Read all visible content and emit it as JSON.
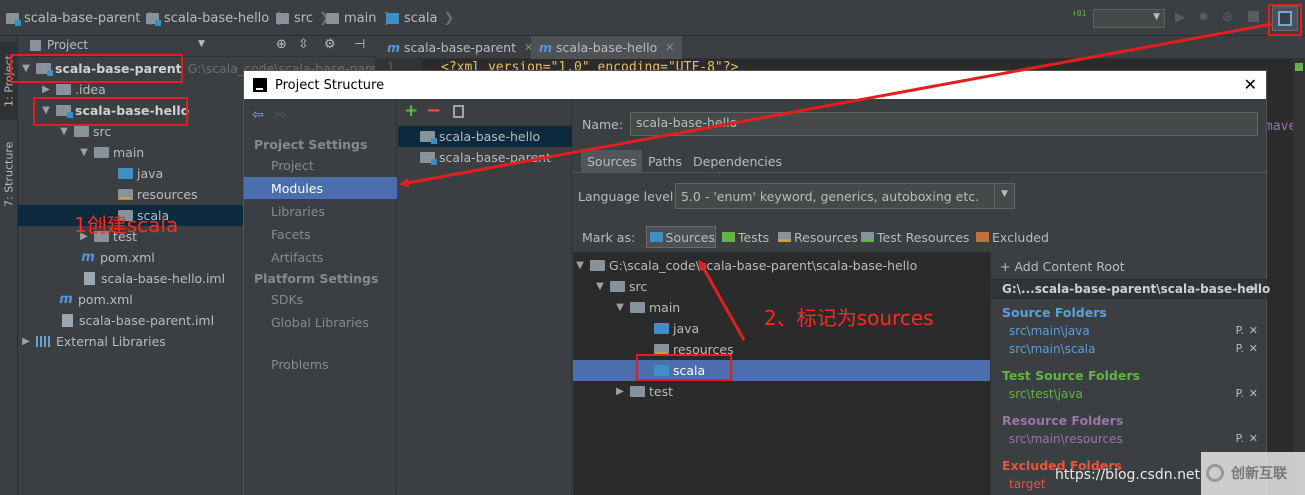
{
  "navbar": {
    "crumbs": [
      "scala-base-parent",
      "scala-base-hello",
      "src",
      "main",
      "scala"
    ]
  },
  "stripe": {
    "project_tab": "1: Project",
    "structure_tab": "7: Structure"
  },
  "project_panel": {
    "title": "Project",
    "tree": [
      {
        "label": "scala-base-parent",
        "path": "G:\\scala_code\\scala-base-parent"
      },
      {
        "label": ".idea"
      },
      {
        "label": "scala-base-hello"
      },
      {
        "label": "src"
      },
      {
        "label": "main"
      },
      {
        "label": "java"
      },
      {
        "label": "resources"
      },
      {
        "label": "scala"
      },
      {
        "label": "test"
      },
      {
        "label": "pom.xml"
      },
      {
        "label": "scala-base-hello.iml"
      },
      {
        "label": "pom.xml"
      },
      {
        "label": "scala-base-parent.iml"
      },
      {
        "label": "External Libraries"
      }
    ]
  },
  "editor": {
    "tabs": [
      {
        "label": "scala-base-parent"
      },
      {
        "label": "scala-base-hello"
      }
    ],
    "line_number": "1",
    "line1": "<?xml version=\"1.0\" encoding=\"UTF-8\"?>",
    "right_fragment": "maver"
  },
  "dialog": {
    "title": "Project Structure",
    "close": "✕",
    "nav": {
      "project_settings_header": "Project Settings",
      "project": "Project",
      "modules": "Modules",
      "libraries": "Libraries",
      "facets": "Facets",
      "artifacts": "Artifacts",
      "platform_settings_header": "Platform Settings",
      "sdks": "SDKs",
      "global_libraries": "Global Libraries",
      "problems": "Problems"
    },
    "modules": [
      "scala-base-hello",
      "scala-base-parent"
    ],
    "name_label": "Name:",
    "name_value": "scala-base-hello",
    "tabs": [
      "Sources",
      "Paths",
      "Dependencies"
    ],
    "language_level_label": "Language level:",
    "language_level_value": "5.0 - 'enum' keyword, generics, autoboxing etc.",
    "mark_as_label": "Mark as:",
    "mark_as": [
      "Sources",
      "Tests",
      "Resources",
      "Test Resources",
      "Excluded"
    ],
    "content_tree": [
      {
        "label": "G:\\scala_code\\scala-base-parent\\scala-base-hello"
      },
      {
        "label": "src"
      },
      {
        "label": "main"
      },
      {
        "label": "java"
      },
      {
        "label": "resources"
      },
      {
        "label": "scala"
      },
      {
        "label": "test"
      }
    ],
    "add_content_root": "+ Add Content Root",
    "root_header": "G:\\...scala-base-parent\\scala-base-hello",
    "source_folders_title": "Source Folders",
    "source_folders": [
      "src\\main\\java",
      "src\\main\\scala"
    ],
    "test_source_folders_title": "Test Source Folders",
    "test_source_folders": [
      "src\\test\\java"
    ],
    "resource_folders_title": "Resource Folders",
    "resource_folders": [
      "src\\main\\resources"
    ],
    "excluded_folders_title": "Excluded Folders",
    "excluded_folders": [
      "target"
    ],
    "folder_props": "P."
  },
  "annotations": {
    "step1": "1创建scala",
    "step2": "2、标记为sources"
  },
  "watermark": {
    "url": "https://blog.csdn.net",
    "logo_text": "创新互联"
  },
  "colors": {
    "accent_selection": "#4b6eaf",
    "annotation_red": "#e02020",
    "source_folder_blue": "#3d8fc6",
    "source_title": "#5c9fdb",
    "test_title": "#62b543",
    "resource_title": "#9876aa",
    "excluded_title": "#e8543f"
  }
}
